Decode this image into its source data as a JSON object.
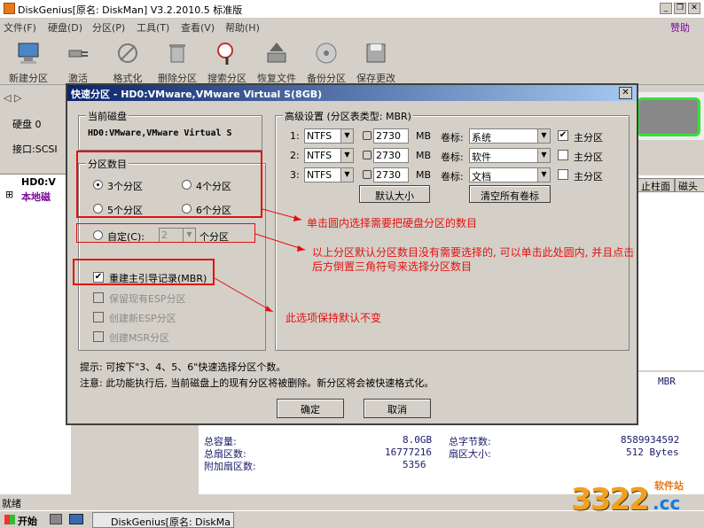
{
  "window": {
    "title": "DiskGenius[原名: DiskMan] V3.2.2010.5 标准版"
  },
  "menu": {
    "items": [
      "文件(F)",
      "硬盘(D)",
      "分区(P)",
      "工具(T)",
      "查看(V)",
      "帮助(H)"
    ],
    "donate": "赞助"
  },
  "toolbar": {
    "items": [
      "新建分区",
      "激活",
      "格式化",
      "删除分区",
      "搜索分区",
      "恢复文件",
      "备份分区",
      "保存更改"
    ]
  },
  "diskpanel": {
    "disk": "硬盘 0",
    "iface": "接口:SCSI"
  },
  "tree": {
    "node1": "HD0:V",
    "node2": "本地磁"
  },
  "columns": {
    "cyl": "止柱面",
    "head": "磁头"
  },
  "info": {
    "mbr": "MBR",
    "total_capacity_label": "总容量:",
    "total_capacity": "8.0GB",
    "total_sectors_label": "总扇区数:",
    "total_sectors": "16777216",
    "extra_sectors_label": "附加扇区数:",
    "extra_sectors": "5356",
    "total_bytes_label": "总字节数:",
    "total_bytes": "8589934592",
    "sector_size_label": "扇区大小:",
    "sector_size": "512 Bytes"
  },
  "status": "就绪",
  "taskbar": {
    "start": "开始",
    "task": "DiskGenius[原名: DiskMa"
  },
  "watermark": {
    "num": "3322",
    "cc": ".cc",
    "site": "软件站"
  },
  "dialog": {
    "title": "快速分区 - HD0:VMware,VMware Virtual S(8GB)",
    "current_disk_label": "当前磁盘",
    "current_disk": "HD0:VMware,VMware Virtual S",
    "count_group": "分区数目",
    "opt3": "3个分区",
    "opt4": "4个分区",
    "opt5": "5个分区",
    "opt6": "6个分区",
    "custom_label": "自定(C):",
    "custom_value": "2",
    "custom_suffix": "个分区",
    "rebuild_mbr": "重建主引导记录(MBR)",
    "keep_esp": "保留现有ESP分区",
    "new_esp": "创建新ESP分区",
    "new_msr": "创建MSR分区",
    "advanced_label": "高级设置 (分区表类型: MBR)",
    "rows": [
      {
        "num": "1:",
        "fs": "NTFS",
        "size": "2730",
        "unit": "MB",
        "vol_label": "卷标:",
        "vol": "系统",
        "primary": "主分区",
        "checked": true
      },
      {
        "num": "2:",
        "fs": "NTFS",
        "size": "2730",
        "unit": "MB",
        "vol_label": "卷标:",
        "vol": "软件",
        "primary": "主分区",
        "checked": false
      },
      {
        "num": "3:",
        "fs": "NTFS",
        "size": "2730",
        "unit": "MB",
        "vol_label": "卷标:",
        "vol": "文档",
        "primary": "主分区",
        "checked": false
      }
    ],
    "default_size": "默认大小",
    "clear_labels": "清空所有卷标",
    "tip": "提示: 可按下\"3、4、5、6\"快速选择分区个数。",
    "note": "注意: 此功能执行后, 当前磁盘上的现有分区将被删除。新分区将会被快速格式化。",
    "ok": "确定",
    "cancel": "取消"
  },
  "annotations": {
    "a1": "单击圆内选择需要把硬盘分区的数目",
    "a2_line1": "以上分区默认分区数目没有需要选择的, 可以单击此处圆内, 并且点击",
    "a2_line2": "后方倒置三角符号来选择分区数目",
    "a3": "此选项保持默认不变"
  }
}
